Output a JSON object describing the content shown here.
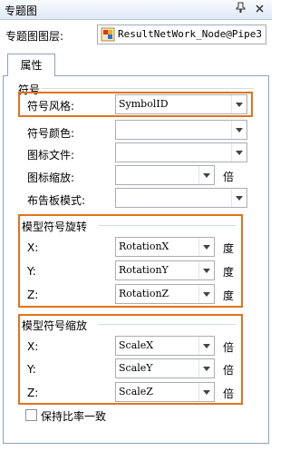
{
  "panel": {
    "title": "专题图",
    "pin_icon": "pin-icon",
    "close_icon": "close-icon"
  },
  "layer": {
    "label": "专题图图层:",
    "value": "ResultNetWork_Node@Pipe3",
    "icon": "layer-icon"
  },
  "tab": {
    "label": "属性"
  },
  "symbol": {
    "group_label": "符号",
    "style_label": "符号风格:",
    "style_value": "SymbolID",
    "color_label": "符号颜色:",
    "color_value": "",
    "icon_file_label": "图标文件:",
    "icon_file_value": "",
    "icon_scale_label": "图标缩放:",
    "icon_scale_value": "",
    "icon_scale_unit": "倍",
    "billboard_label": "布告板模式:",
    "billboard_value": ""
  },
  "rotation": {
    "group_label": "模型符号旋转",
    "x_label": "X:",
    "x_value": "RotationX",
    "y_label": "Y:",
    "y_value": "RotationY",
    "z_label": "Z:",
    "z_value": "RotationZ",
    "unit": "度"
  },
  "scale": {
    "group_label": "模型符号缩放",
    "x_label": "X:",
    "x_value": "ScaleX",
    "y_label": "Y:",
    "y_value": "ScaleY",
    "z_label": "Z:",
    "z_value": "ScaleZ",
    "unit": "倍"
  },
  "keep_ratio": {
    "label": "保持比率一致",
    "checked": false
  },
  "colors": {
    "highlight": "#e0731c",
    "titlebar": "#dfe9f5"
  }
}
